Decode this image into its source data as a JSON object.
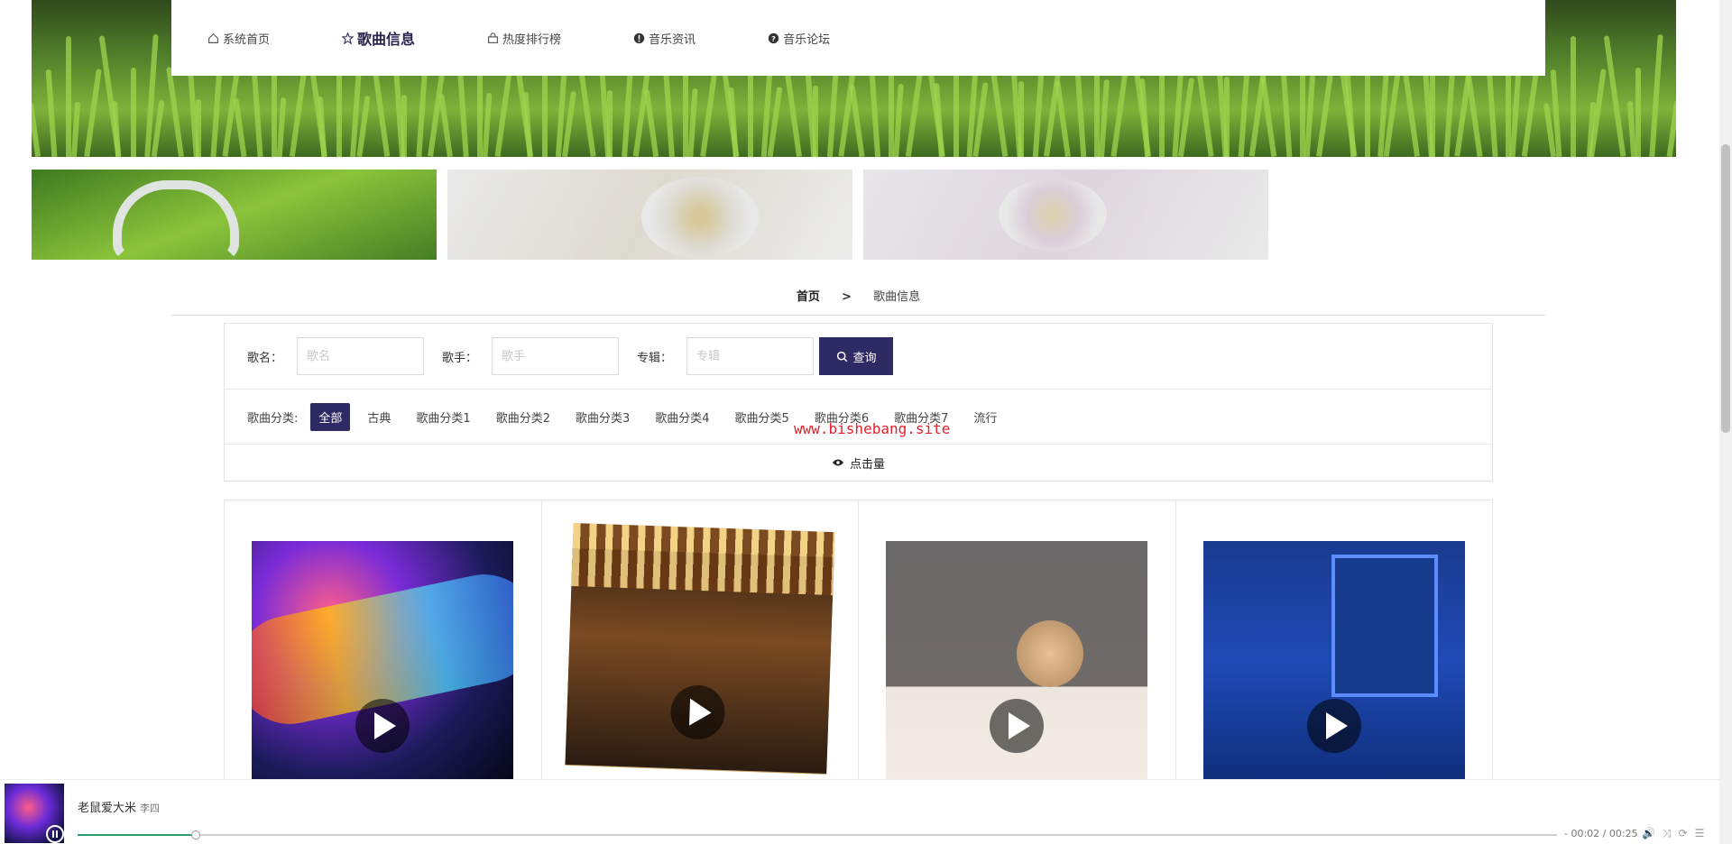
{
  "nav": {
    "items": [
      {
        "label": "系统首页",
        "icon": "home-icon",
        "active": false
      },
      {
        "label": "歌曲信息",
        "icon": "star-icon",
        "active": true
      },
      {
        "label": "热度排行榜",
        "icon": "bag-icon",
        "active": false
      },
      {
        "label": "音乐资讯",
        "icon": "alert-icon",
        "active": false
      },
      {
        "label": "音乐论坛",
        "icon": "question-icon",
        "active": false
      }
    ]
  },
  "breadcrumb": {
    "home": "首页",
    "separator": ">",
    "current": "歌曲信息"
  },
  "search": {
    "song_label": "歌名：",
    "song_placeholder": "歌名",
    "singer_label": "歌手：",
    "singer_placeholder": "歌手",
    "album_label": "专辑：",
    "album_placeholder": "专辑",
    "query_label": "查询"
  },
  "categories": {
    "label": "歌曲分类:",
    "items": [
      "全部",
      "古典",
      "歌曲分类1",
      "歌曲分类2",
      "歌曲分类3",
      "歌曲分类4",
      "歌曲分类5",
      "歌曲分类6",
      "歌曲分类7",
      "流行"
    ],
    "active": "全部"
  },
  "sort": {
    "label": "点击量"
  },
  "watermark": "www.bishebang.site",
  "songs": [
    {
      "cover": "colorful-music-notes"
    },
    {
      "cover": "secret-group-stage"
    },
    {
      "cover": "jinchi-moon"
    },
    {
      "cover": "blue-window-night"
    }
  ],
  "player": {
    "title": "老鼠爱大米",
    "artist": "李四",
    "elapsed": "- 00:02",
    "duration": "00:25",
    "progress": 0.08,
    "accent": "#2e9b6e"
  },
  "colors": {
    "primary": "#2e2a63",
    "watermark": "#e0202a"
  }
}
